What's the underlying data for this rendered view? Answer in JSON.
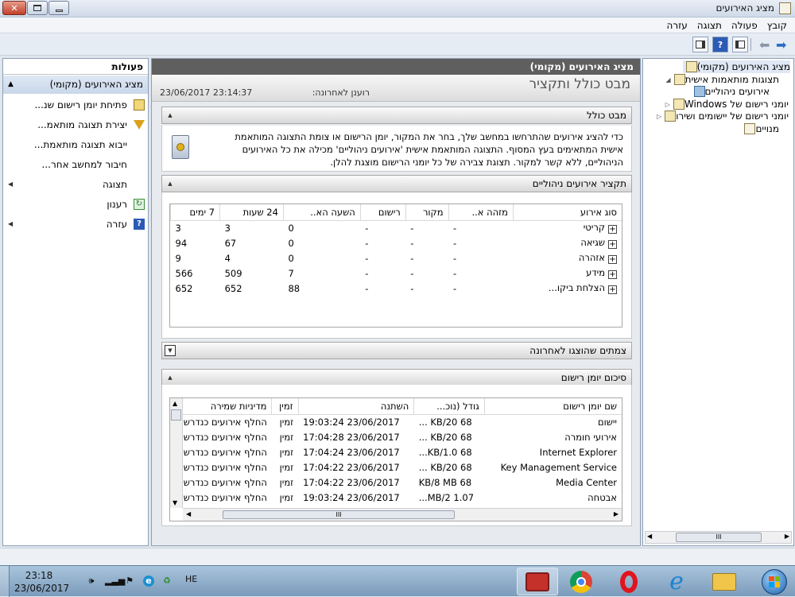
{
  "window": {
    "title": "מציג האירועים",
    "close": "✕"
  },
  "menu": [
    "קובץ",
    "פעולה",
    "תצוגה",
    "עזרה"
  ],
  "tree": {
    "items": [
      {
        "label": "מציג האירועים (מקומי)",
        "icon": "event-viewer-icon"
      },
      {
        "label": "תצוגות מותאמות אישית",
        "icon": "folder-icon"
      },
      {
        "label": "אירועים ניהוליים",
        "icon": "filter-icon"
      },
      {
        "label": "יומני רישום של Windows",
        "icon": "folder-icon"
      },
      {
        "label": "יומני רישום של יישומים ושירו",
        "icon": "folder-icon"
      },
      {
        "label": "מנויים",
        "icon": "subscription-icon"
      }
    ],
    "scroll_mark": "III"
  },
  "center": {
    "header": "מציג האירועים (מקומי)",
    "banner_title": "מבט כולל ותקציר",
    "refresh_label": "רוענן לאחרונה:",
    "refresh_time": "23/06/2017 23:14:37",
    "overview": {
      "title": "מבט כולל",
      "text": "כדי להציג אירועים שהתרחשו במחשב שלך, בחר את המקור, יומן הרישום או צומת התצוגה המותאמת אישית המתאימים בעץ המסוף. התצוגה המותאמת אישית 'אירועים ניהוליים' מכילה את כל האירועים הניהוליים, ללא קשר למקור. תצוגת צבירה של כל יומני הרישום מוצגת להלן."
    },
    "summary": {
      "title": "תקציר אירועים ניהוליים",
      "columns": [
        "סוג אירוע",
        "מזהה א..",
        "מקור",
        "רישום",
        "השעה הא..",
        "24 שעות",
        "7 ימים"
      ],
      "rows": [
        [
          "קריטי",
          "-",
          "-",
          "-",
          "0",
          "3",
          "3"
        ],
        [
          "שגיאה",
          "-",
          "-",
          "-",
          "0",
          "67",
          "94"
        ],
        [
          "אזהרה",
          "-",
          "-",
          "-",
          "0",
          "4",
          "9"
        ],
        [
          "מידע",
          "-",
          "-",
          "-",
          "7",
          "509",
          "566"
        ],
        [
          "הצלחת ביקו...",
          "-",
          "-",
          "-",
          "88",
          "652",
          "652"
        ]
      ]
    },
    "recent_nodes": {
      "title": "צמתים שהוצגו לאחרונה"
    },
    "log_summary": {
      "title": "סיכום יומן רישום",
      "columns": [
        "שם יומן רישום",
        "גודל (נוכ...",
        "השתנה",
        "זמין",
        "מדיניות שמירה"
      ],
      "rows": [
        [
          "יישום",
          "68 KB/20 ...",
          "23/06/2017 19:03:24",
          "זמין",
          "החלף אירועים כנדרש"
        ],
        [
          "אירועי חומרה",
          "68 KB/20 ...",
          "23/06/2017 17:04:28",
          "זמין",
          "החלף אירועים כנדרש"
        ],
        [
          "Internet Explorer",
          "68 KB/1.0...",
          "23/06/2017 17:04:24",
          "זמין",
          "החלף אירועים כנדרש"
        ],
        [
          "Key Management Service",
          "68 KB/20 ...",
          "23/06/2017 17:04:22",
          "זמין",
          "החלף אירועים כנדרש"
        ],
        [
          "Media Center",
          "68 KB/8 MB",
          "23/06/2017 17:04:22",
          "זמין",
          "החלף אירועים כנדרש"
        ],
        [
          "אבטחה",
          "1.07 MB/2...",
          "23/06/2017 19:03:24",
          "זמין",
          "החלף אירועים כנדרש"
        ]
      ],
      "scroll_mark": "III"
    }
  },
  "actions": {
    "title": "פעולות",
    "group": "מציג האירועים (מקומי)",
    "items": [
      {
        "label": "פתיחת יומן רישום שנ...",
        "icon": "open-folder-icon"
      },
      {
        "label": "יצירת תצוגה מותאמ...",
        "icon": "filter-icon"
      },
      {
        "label": "ייבוא תצוגה מותאמת...",
        "icon": ""
      },
      {
        "label": "חיבור למחשב אחר...",
        "icon": ""
      },
      {
        "label": "תצוגה",
        "icon": "",
        "submenu": true
      },
      {
        "label": "רענון",
        "icon": "refresh-icon"
      },
      {
        "label": "עזרה",
        "icon": "help-icon",
        "submenu": true
      }
    ]
  },
  "taskbar": {
    "time": "23:18",
    "date": "23/06/2017",
    "lang": "HE"
  }
}
